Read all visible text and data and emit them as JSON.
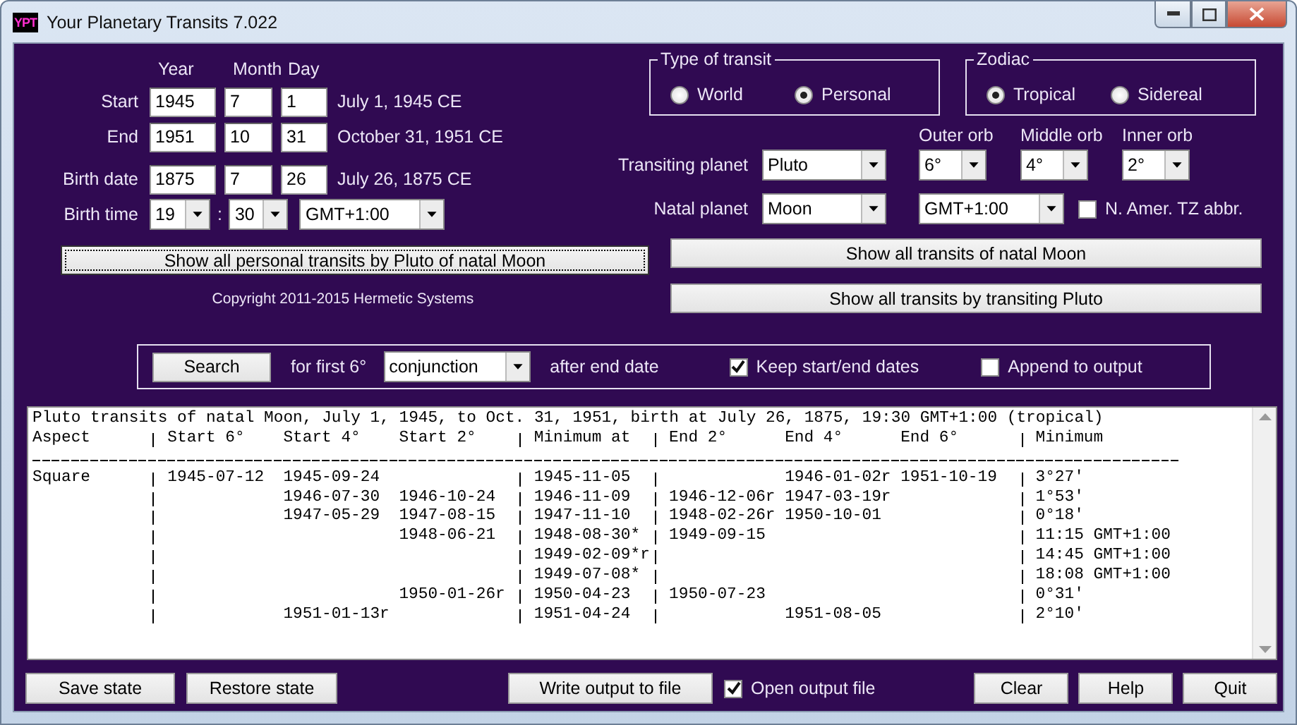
{
  "window": {
    "icon_text": "YPT",
    "title": "Your Planetary Transits 7.022"
  },
  "dates": {
    "headers": [
      "Year",
      "Month",
      "Day"
    ],
    "rows": [
      {
        "label": "Start",
        "year": "1945",
        "month": "7",
        "day": "1",
        "caption": "July 1, 1945 CE"
      },
      {
        "label": "End",
        "year": "1951",
        "month": "10",
        "day": "31",
        "caption": "October 31, 1951 CE"
      },
      {
        "label": "Birth date",
        "year": "1875",
        "month": "7",
        "day": "26",
        "caption": "July 26, 1875 CE"
      }
    ]
  },
  "birth_time": {
    "label": "Birth time",
    "hour": "19",
    "separator": ":",
    "minute": "30",
    "timezone": "GMT+1:00"
  },
  "main_button": {
    "label": "Show all personal transits by Pluto of natal Moon",
    "focused": true
  },
  "copyright": "Copyright 2011-2015 Hermetic Systems",
  "transit_type": {
    "title": "Type of transit",
    "options": [
      {
        "label": "World",
        "selected": false
      },
      {
        "label": "Personal",
        "selected": true
      }
    ]
  },
  "zodiac": {
    "title": "Zodiac",
    "options": [
      {
        "label": "Tropical",
        "selected": true
      },
      {
        "label": "Sidereal",
        "selected": false
      }
    ]
  },
  "orbs": [
    {
      "label": "Outer orb",
      "value": "6°"
    },
    {
      "label": "Middle orb",
      "value": "4°"
    },
    {
      "label": "Inner orb",
      "value": "2°"
    }
  ],
  "transiting_planet": {
    "label": "Transiting planet",
    "value": "Pluto"
  },
  "natal_planet": {
    "label": "Natal planet",
    "value": "Moon"
  },
  "natal_timezone": "GMT+1:00",
  "tz_abbr": {
    "label": "N. Amer. TZ abbr.",
    "checked": false
  },
  "right_buttons": [
    "Show all transits of natal Moon",
    "Show all transits by transiting Pluto"
  ],
  "search_bar": {
    "button": "Search",
    "prefix": "for first 6°",
    "aspect": "conjunction",
    "suffix": "after end date",
    "checks": [
      {
        "label": "Keep start/end dates",
        "checked": true
      },
      {
        "label": "Append to output",
        "checked": false
      }
    ]
  },
  "output": {
    "title": "Pluto transits of natal Moon, July 1, 1945, to Oct. 31, 1951, birth at July 26, 1875, 19:30 GMT+1:00 (tropical)",
    "header": {
      "aspect": "Aspect",
      "start_6": "Start 6°",
      "start_4": "Start 4°",
      "start_2": "Start 2°",
      "minimum_at": "Minimum at",
      "end_2": "End 2°",
      "end_4": "End 4°",
      "end_6": "End 6°",
      "minimum": "Minimum"
    },
    "rows": [
      {
        "aspect": "Square",
        "start_6": "1945-07-12",
        "start_4": "1945-09-24",
        "minimum_at": "1945-11-05",
        "end_4": "1946-01-02r",
        "end_6": "1951-10-19",
        "minimum": "3°27'"
      },
      {
        "start_4": "1946-07-30",
        "start_2": "1946-10-24",
        "minimum_at": "1946-11-09",
        "end_2": "1946-12-06r",
        "end_4": "1947-03-19r",
        "minimum": "1°53'"
      },
      {
        "start_4": "1947-05-29",
        "start_2": "1947-08-15",
        "minimum_at": "1947-11-10",
        "end_2": "1948-02-26r",
        "end_4": "1950-10-01",
        "minimum": "0°18'"
      },
      {
        "start_2": "1948-06-21",
        "minimum_at": "1948-08-30*",
        "end_2": "1949-09-15",
        "minimum": "11:15 GMT+1:00"
      },
      {
        "minimum_at": "1949-02-09*r",
        "minimum": "14:45 GMT+1:00"
      },
      {
        "minimum_at": "1949-07-08*",
        "minimum": "18:08 GMT+1:00"
      },
      {
        "start_2": "1950-01-26r",
        "minimum_at": "1950-04-23",
        "end_2": "1950-07-23",
        "minimum": "0°31'"
      },
      {
        "start_4": "1951-01-13r",
        "minimum_at": "1951-04-24",
        "end_4": "1951-08-05",
        "minimum": "2°10'"
      }
    ]
  },
  "footer": {
    "left_buttons": [
      "Save state",
      "Restore state"
    ],
    "write_button": "Write output to file",
    "open_output": {
      "label": "Open output file",
      "checked": true
    },
    "right_buttons": [
      "Clear",
      "Help",
      "Quit"
    ]
  }
}
